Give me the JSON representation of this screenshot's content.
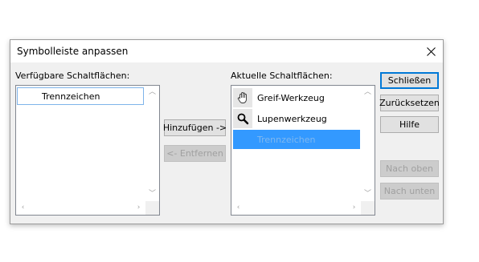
{
  "dialog": {
    "title": "Symbolleiste anpassen",
    "close_label": "✕"
  },
  "available": {
    "label": "Verfügbare Schaltflächen:",
    "items": [
      {
        "label": "Trennzeichen",
        "selected": true
      }
    ]
  },
  "current": {
    "label": "Aktuelle Schaltflächen:",
    "items": [
      {
        "label": "Greif-Werkzeug",
        "icon": "hand-icon"
      },
      {
        "label": "Lupenwerkzeug",
        "icon": "magnifier-icon"
      },
      {
        "label": "Trennzeichen",
        "icon": "none",
        "selected": true
      }
    ]
  },
  "buttons": {
    "add": "Hinzufügen ->",
    "remove": "<- Entfernen",
    "close": "Schließen",
    "reset": "Zurücksetzen",
    "help": "Hilfe",
    "move_up": "Nach oben",
    "move_down": "Nach unten"
  },
  "colors": {
    "accent": "#0078d7",
    "selection_bg": "#3399ff",
    "selection_text": "#7fb8f0",
    "disabled_text": "#a0a0a0"
  }
}
